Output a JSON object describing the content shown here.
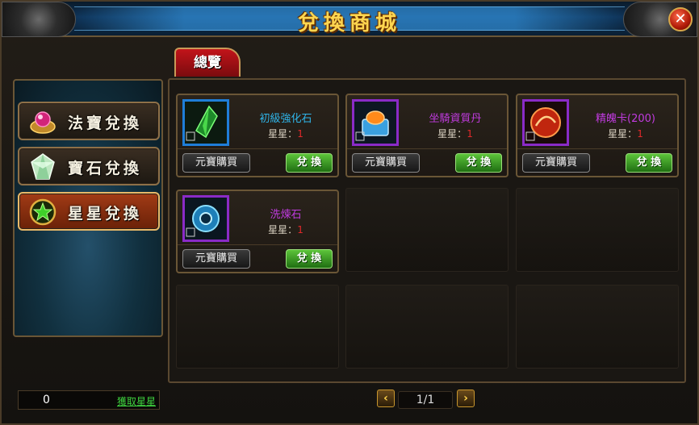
{
  "window": {
    "title": "兌換商城"
  },
  "tabs": [
    {
      "label": "總覽"
    }
  ],
  "sidebar": {
    "items": [
      {
        "label": "法寶兌換",
        "icon": "artifact-icon",
        "active": false
      },
      {
        "label": "寶石兌換",
        "icon": "gem-icon",
        "active": false
      },
      {
        "label": "星星兌換",
        "icon": "star-icon",
        "active": true
      }
    ],
    "stars_count": "0",
    "get_stars_label": "獲取星星"
  },
  "items": [
    {
      "name": "初級強化石",
      "stars_label": "星星：",
      "stars_value": "1",
      "icon": "green-crystal-icon",
      "buy_label": "元寶購買",
      "exchange_label": "兌 換"
    },
    {
      "name": "坐騎資質丹",
      "stars_label": "星星：",
      "stars_value": "1",
      "icon": "mount-pill-icon",
      "buy_label": "元寶購買",
      "exchange_label": "兌 換"
    },
    {
      "name": "精魄卡(200)",
      "stars_label": "星星：",
      "stars_value": "1",
      "icon": "spirit-card-icon",
      "buy_label": "元寶購買",
      "exchange_label": "兌 換"
    },
    {
      "name": "洗煉石",
      "stars_label": "星星：",
      "stars_value": "1",
      "icon": "refine-stone-icon",
      "buy_label": "元寶購買",
      "exchange_label": "兌 換"
    }
  ],
  "pager": {
    "label": "1/1"
  }
}
